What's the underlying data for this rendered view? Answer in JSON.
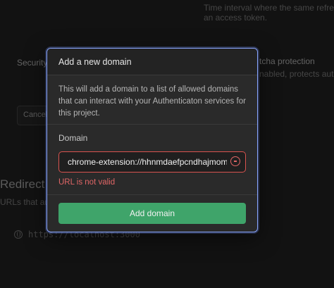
{
  "background": {
    "top_text_1": "Time interval where the same refresh",
    "top_text_2": "an access token.",
    "security_label": "Security",
    "captcha_label": "tcha protection",
    "captcha_desc": "nabled, protects auth e",
    "cancel_label": "Cancel",
    "redirect_title": "Redirect U",
    "redirect_desc": "URLs that aut",
    "redirect_url": "https://localhost:3000"
  },
  "modal": {
    "title": "Add a new domain",
    "description": "This will add a domain to a list of allowed domains that can interact with your Authenticaton services for this project.",
    "field_label": "Domain",
    "field_value": "chrome-extension://hhnmdaefpcndhajmomipkcn",
    "error": "URL is not valid",
    "submit_label": "Add domain",
    "accent_color": "#3fa46a",
    "error_color": "#e06666"
  }
}
